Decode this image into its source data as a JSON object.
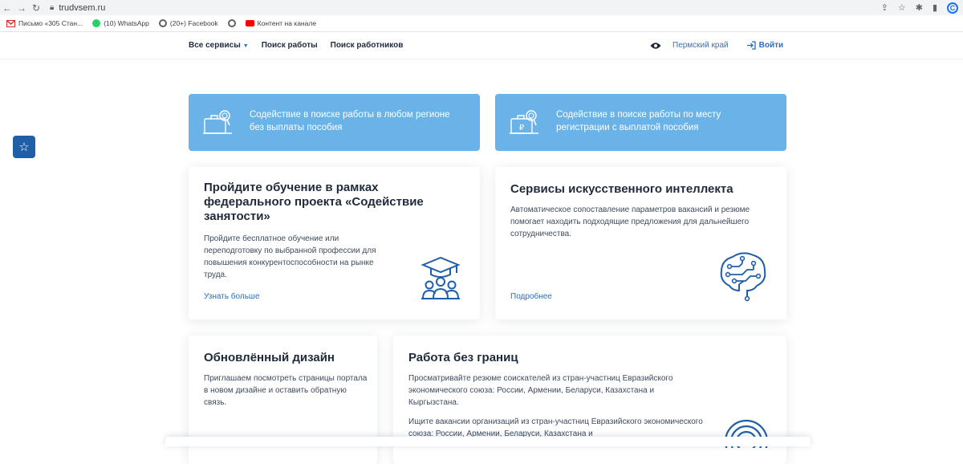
{
  "browser": {
    "url": "trudvsem.ru",
    "profile_letter": "C",
    "bookmarks": [
      {
        "label": "Письмо «305 Стан...",
        "color": "#d93025"
      },
      {
        "label": "(10) WhatsApp",
        "color": "#25d366"
      },
      {
        "label": "(20+) Facebook",
        "color": "#5f6368"
      },
      {
        "label": "",
        "color": "#5f6368"
      },
      {
        "label": "Контент на канале",
        "color": "#ff0000"
      }
    ]
  },
  "header": {
    "nav": [
      "Все сервисы",
      "Поиск работы",
      "Поиск работников"
    ],
    "region": "Пермский край",
    "login": "Войти"
  },
  "promos": [
    {
      "text": "Содействие в поиске работы в любом регионе без выплаты пособия",
      "icon": "briefcase-search-icon"
    },
    {
      "text": "Содействие в поиске работы по месту регистрации с выплатой пособия",
      "icon": "ruble-briefcase-search-icon"
    }
  ],
  "cards": {
    "training": {
      "title": "Пройдите обучение в рамках федерального проекта «Содействие занятости»",
      "text": "Пройдите бесплатное обучение или переподготовку по выбранной профессии для повышения конкурентоспособности на рынке труда.",
      "link": "Узнать больше",
      "icon": "graduates-icon"
    },
    "ai": {
      "title": "Сервисы искусственного интеллекта",
      "text": "Автоматическое сопоставление параметров вакансий и резюме помогает находить подходящие предложения для дальнейшего сотрудничества.",
      "link": "Подробнее",
      "icon": "brain-circuit-icon"
    },
    "design": {
      "title": "Обновлённый дизайн",
      "text": "Приглашаем посмотреть страницы портала в новом дизайне и оставить обратную связь."
    },
    "borders": {
      "title": "Работа без границ",
      "text1": "Просматривайте резюме соискателей из стран-участниц Евразийского экономического союза: России, Армении, Беларуси, Казахстана и Кыргызстана.",
      "text2": "Ищите вакансии организаций из стран-участниц Евразийского экономического союза: России, Армении, Беларуси, Казахстана и",
      "icon": "globe-icon"
    }
  },
  "colors": {
    "promo": "#6ab3e8",
    "accent": "#2a6fbd",
    "fav": "#1f5fa8"
  }
}
